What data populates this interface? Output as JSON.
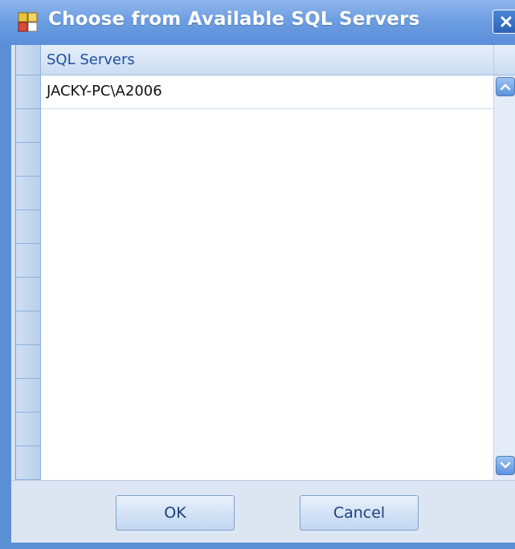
{
  "window": {
    "title": "Choose from Available SQL Servers",
    "close_icon": "close-icon",
    "app_icon": "app-icon"
  },
  "grid": {
    "columns": [
      "SQL Servers"
    ],
    "rows": [
      [
        "JACKY-PC\\A2006"
      ]
    ]
  },
  "scrollbar": {
    "up_icon": "chevron-up-icon",
    "down_icon": "chevron-down-icon"
  },
  "buttons": {
    "ok_label": "OK",
    "cancel_label": "Cancel"
  },
  "colors": {
    "titlebar": "#6d9ee2",
    "frame": "#5b8fd4",
    "header_text": "#1f4fa0"
  }
}
